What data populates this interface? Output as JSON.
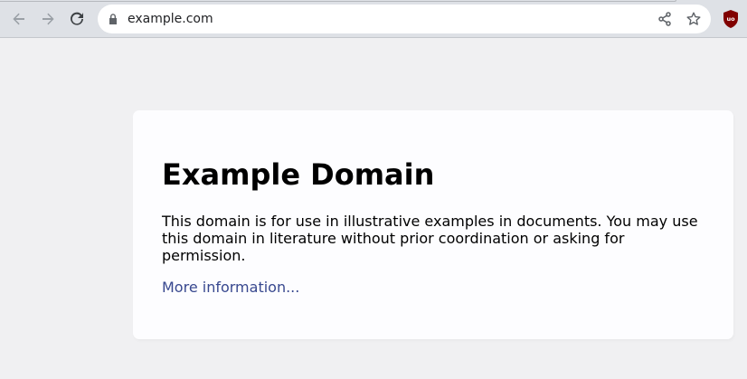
{
  "browser": {
    "url": "example.com",
    "back_label": "Back",
    "forward_label": "Forward",
    "reload_label": "Reload",
    "share_label": "Share",
    "bookmark_label": "Bookmark this tab",
    "extension_label": "uBlock Origin",
    "icons": [
      "back-arrow-icon",
      "forward-arrow-icon",
      "reload-icon",
      "lock-icon",
      "share-icon",
      "star-icon",
      "ublock-origin-icon"
    ],
    "colors": {
      "toolbar": "#dee1e6",
      "omnibox": "#ffffff",
      "icon": "#5f6368",
      "icon_disabled": "#9aa0a6",
      "extension": "#800000"
    }
  },
  "page": {
    "title": "Example Domain",
    "body": "This domain is for use in illustrative examples in documents. You may use this domain in literature without prior coordination or asking for permission.",
    "link_text": "More information...",
    "colors": {
      "background": "#f0f0f2",
      "card": "#fdfdff",
      "link": "#38488f"
    }
  }
}
